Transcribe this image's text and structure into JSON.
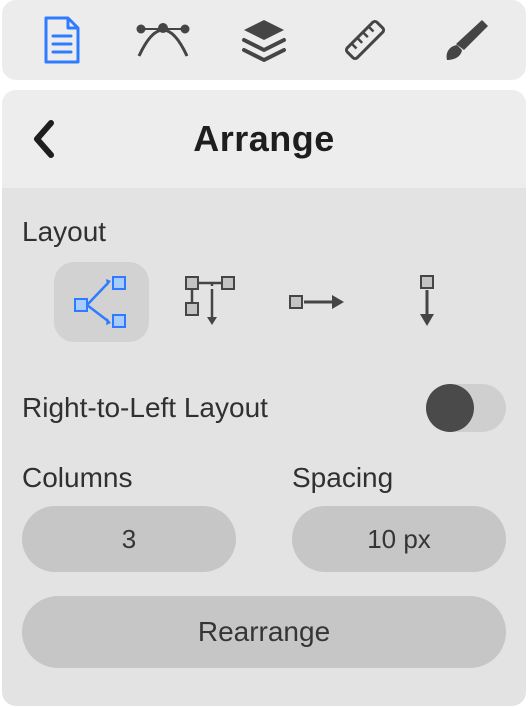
{
  "tabbar": {
    "items": [
      {
        "name": "document-tab",
        "icon": "document-icon",
        "active": true
      },
      {
        "name": "vector-tab",
        "icon": "vector-icon",
        "active": false
      },
      {
        "name": "layers-tab",
        "icon": "layers-icon",
        "active": false
      },
      {
        "name": "ruler-tab",
        "icon": "ruler-icon",
        "active": false
      },
      {
        "name": "brush-tab",
        "icon": "brush-icon",
        "active": false
      }
    ]
  },
  "header": {
    "title": "Arrange",
    "back": "back-button"
  },
  "layout_section": {
    "label": "Layout",
    "options": [
      {
        "name": "layout-flow",
        "selected": true
      },
      {
        "name": "layout-tree",
        "selected": false
      },
      {
        "name": "layout-horizontal",
        "selected": false
      },
      {
        "name": "layout-vertical",
        "selected": false
      }
    ]
  },
  "rtl": {
    "label": "Right-to-Left Layout",
    "enabled": false
  },
  "columns": {
    "label": "Columns",
    "value": "3"
  },
  "spacing": {
    "label": "Spacing",
    "value": "10 px"
  },
  "rearrange_label": "Rearrange",
  "colors": {
    "accent": "#2f7bff",
    "icon_dark": "#454545",
    "bg_light": "#ececec",
    "bg_panel": "#e3e3e3",
    "pill": "#c6c6c6"
  }
}
